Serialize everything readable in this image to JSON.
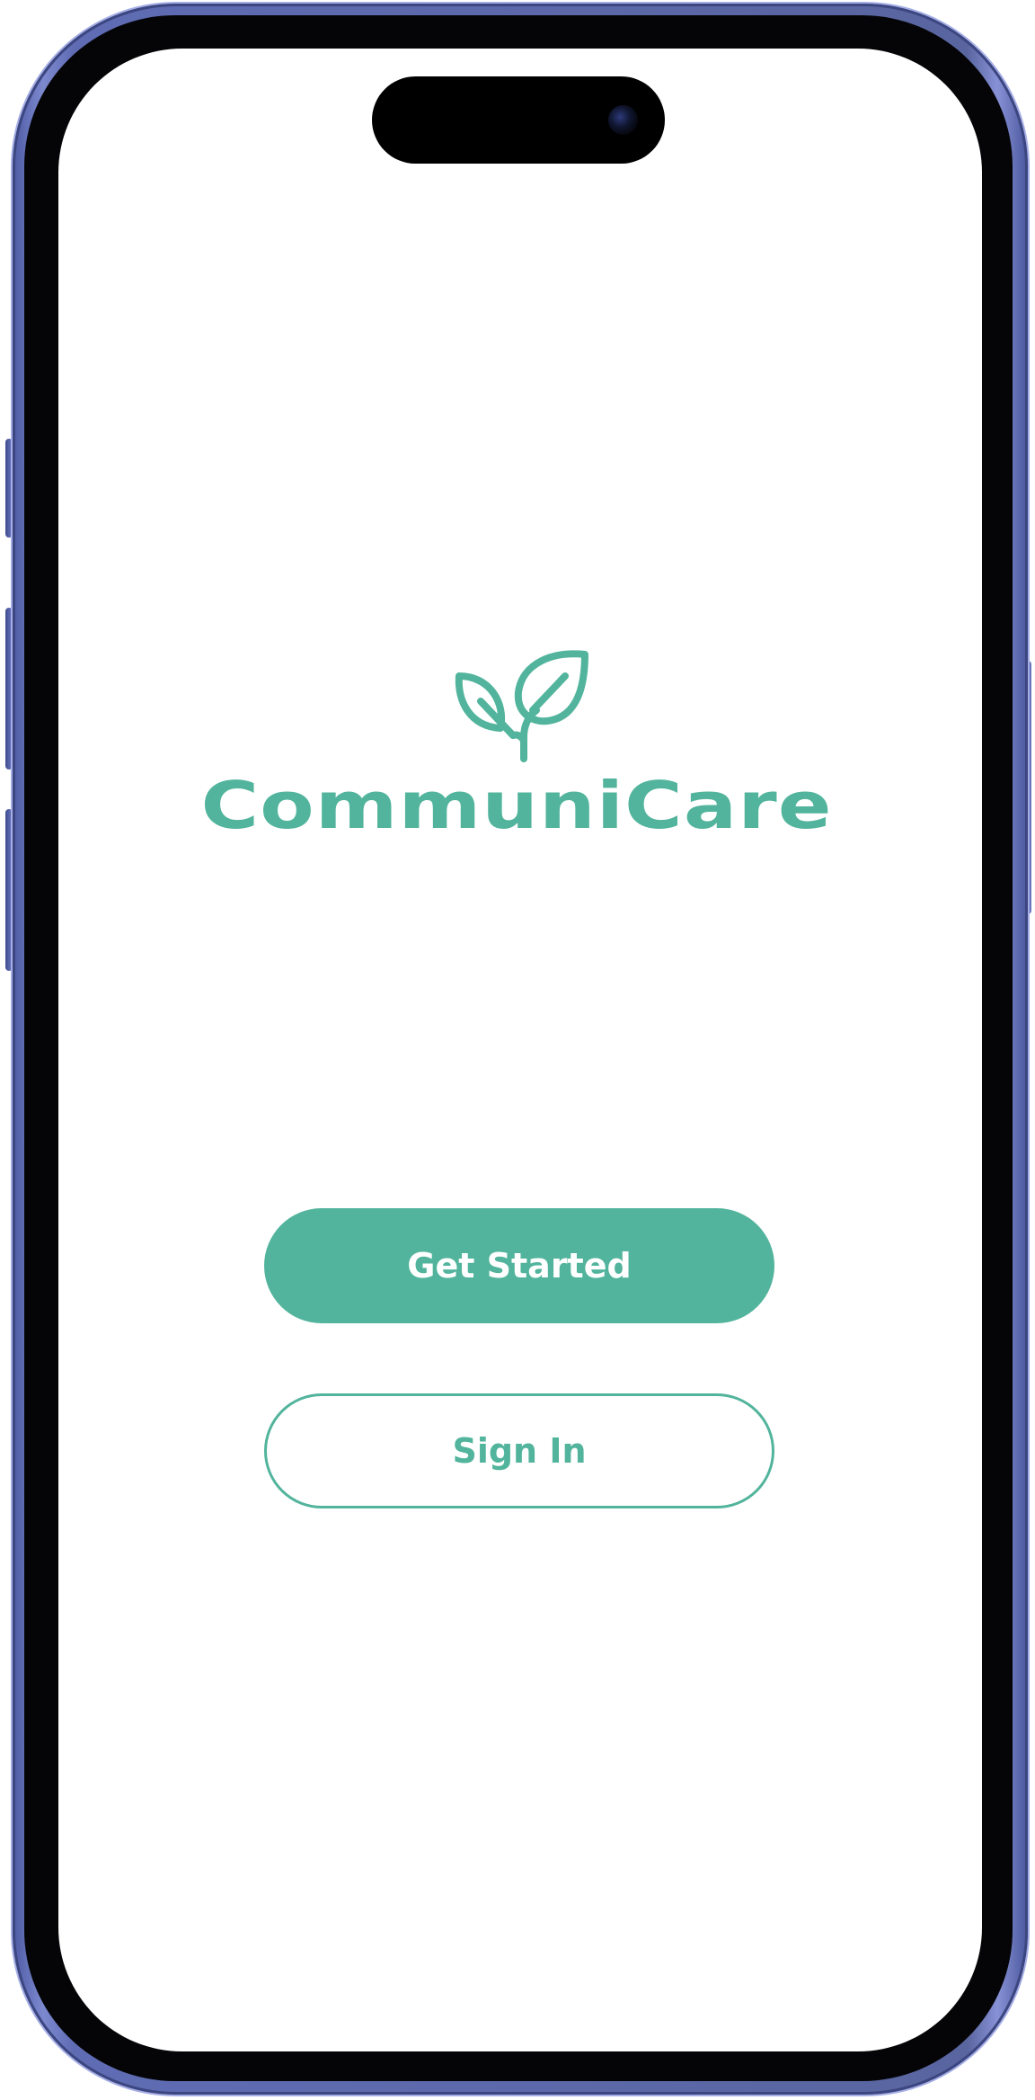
{
  "app": {
    "name": "CommuniCare",
    "logo_icon": "sprout-leaves-icon"
  },
  "actions": {
    "primary_label": "Get Started",
    "secondary_label": "Sign In"
  },
  "colors": {
    "brand": "#52b49c",
    "on_brand": "#ffffff",
    "frame": "#5f6cb4",
    "screen_background": "#ffffff"
  }
}
